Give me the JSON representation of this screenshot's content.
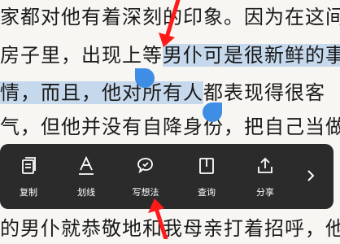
{
  "reader": {
    "lines": [
      {
        "a": "家都对他有着深刻的印象。因为在这间"
      },
      {
        "a": "房子里，出现上等",
        "b": "男仆可是很新鲜的事"
      },
      {
        "b": "情，而且，他对所有人",
        "c": "都表现得很客"
      },
      {
        "a": "气，但他并没有自降身份，把自己当做"
      },
      {
        "a": "的男仆就恭敬地和我母亲打着招呼，他"
      }
    ]
  },
  "toolbar": {
    "items": [
      {
        "label": "复制",
        "icon": "copy-icon"
      },
      {
        "label": "划线",
        "icon": "underline-icon"
      },
      {
        "label": "写想法",
        "icon": "note-icon"
      },
      {
        "label": "查询",
        "icon": "lookup-icon"
      },
      {
        "label": "分享",
        "icon": "share-icon"
      }
    ],
    "more_icon": "chevron-right-icon"
  },
  "colors": {
    "highlight": "#c5d8ec",
    "handle": "#3f8ee6",
    "toolbar_bg": "#2b2b2b",
    "arrow": "#ff1a1a"
  }
}
